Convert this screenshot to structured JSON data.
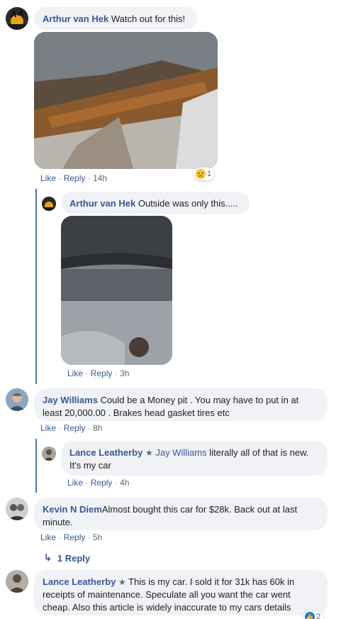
{
  "comments": [
    {
      "name": "Arthur van Hek",
      "text": "Watch out for this!",
      "like": "Like",
      "reply": "Reply",
      "time": "14h",
      "reaction_count": "1"
    },
    {
      "name": "Arthur van Hek",
      "text": "Outside was only this.....",
      "like": "Like",
      "reply": "Reply",
      "time": "3h"
    },
    {
      "name": "Jay Williams",
      "text": "Could be a Money pit . You may have to put in at least 20,000.00 . Brakes head gasket tires etc",
      "like": "Like",
      "reply": "Reply",
      "time": "8h"
    },
    {
      "name": "Lance Leatherby",
      "mention": "Jay Williams",
      "text": "literally all of that is new. It's my car",
      "like": "Like",
      "reply": "Reply",
      "time": "4h"
    },
    {
      "name": "Kevin N Diem",
      "text": "Almost bought this car for $28k. Back out at last minute.",
      "like": "Like",
      "reply": "Reply",
      "time": "5h",
      "replies_label": "1 Reply"
    },
    {
      "name": "Lance Leatherby",
      "text": "This is my car. I sold it for 31k has 60k in receipts of maintenance. Speculate all you want the car went cheap. Also this article is widely inaccurate to my cars details",
      "reaction_count": "2"
    }
  ],
  "separator": "·",
  "colors": {
    "link": "#385898",
    "bubble": "#f0f2f5",
    "thread_line": "#4a76a8"
  }
}
